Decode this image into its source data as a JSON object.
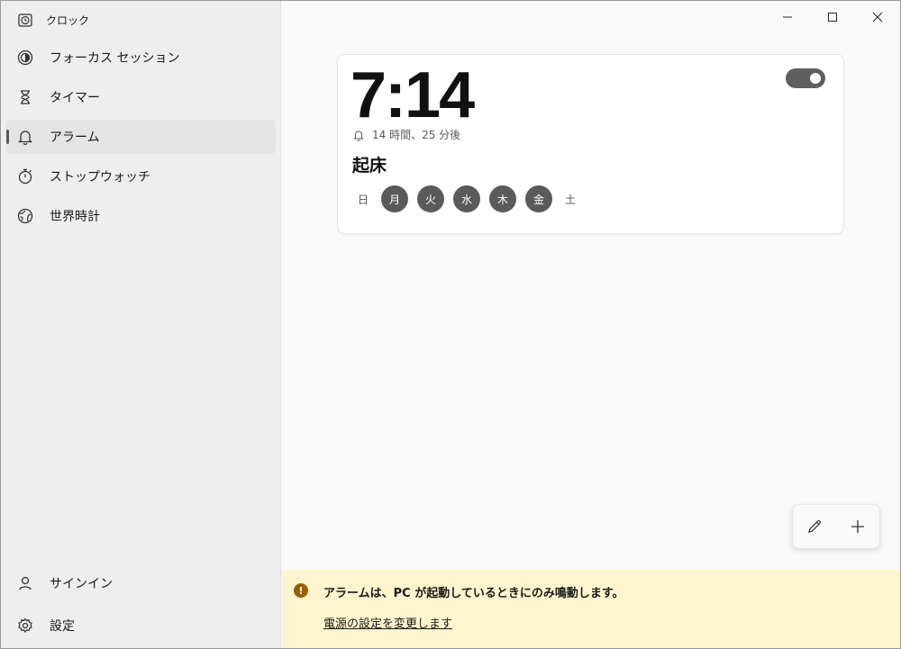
{
  "app": {
    "title": "クロック"
  },
  "sidebar": {
    "items": [
      {
        "label": "フォーカス セッション",
        "icon": "focus-icon"
      },
      {
        "label": "タイマー",
        "icon": "hourglass-icon"
      },
      {
        "label": "アラーム",
        "icon": "bell-icon",
        "active": true
      },
      {
        "label": "ストップウォッチ",
        "icon": "stopwatch-icon"
      },
      {
        "label": "世界時計",
        "icon": "globe-icon"
      }
    ],
    "bottom": [
      {
        "label": "サインイン",
        "icon": "person-icon"
      },
      {
        "label": "設定",
        "icon": "gear-icon"
      }
    ]
  },
  "alarm": {
    "time": "7:14",
    "enabled": true,
    "remaining": "14 時間、25 分後",
    "name": "起床",
    "days": [
      {
        "label": "日",
        "on": false
      },
      {
        "label": "月",
        "on": true
      },
      {
        "label": "火",
        "on": true
      },
      {
        "label": "水",
        "on": true
      },
      {
        "label": "木",
        "on": true
      },
      {
        "label": "金",
        "on": true
      },
      {
        "label": "土",
        "on": false
      }
    ]
  },
  "fab": {
    "edit_icon": "pencil-icon",
    "add_icon": "plus-icon"
  },
  "infobar": {
    "message": "アラームは、PC が起動しているときにのみ鳴動します。",
    "link": "電源の設定を変更します"
  },
  "colors": {
    "accent": "#5a5a5a",
    "infobar_bg": "#fff4ce",
    "warning_icon": "#9d5d00"
  }
}
